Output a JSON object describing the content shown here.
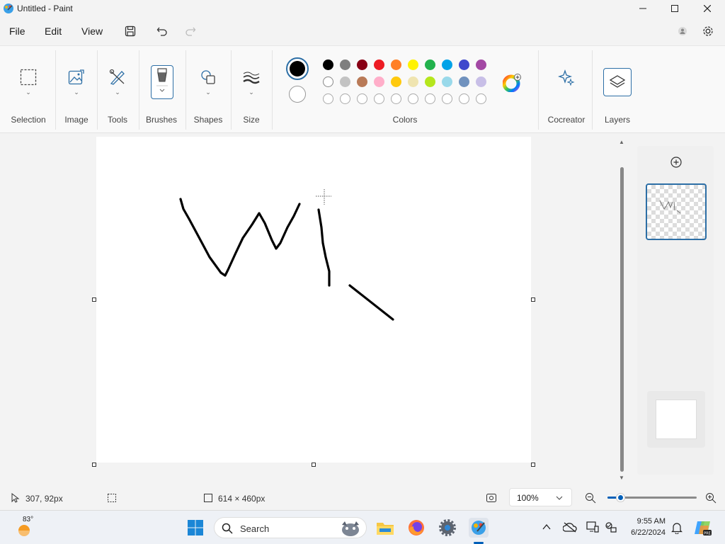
{
  "window": {
    "title": "Untitled - Paint"
  },
  "menu": {
    "file": "File",
    "edit": "Edit",
    "view": "View"
  },
  "ribbon": {
    "groups": [
      {
        "label": "Selection"
      },
      {
        "label": "Image"
      },
      {
        "label": "Tools"
      },
      {
        "label": "Brushes"
      },
      {
        "label": "Shapes"
      },
      {
        "label": "Size"
      },
      {
        "label": "Colors"
      },
      {
        "label": "Cocreator"
      },
      {
        "label": "Layers"
      }
    ],
    "colors": {
      "primary": "#000000",
      "secondary": "#ffffff",
      "palette_row1": [
        "#000000",
        "#7f7f7f",
        "#880015",
        "#ed1c24",
        "#ff7f27",
        "#fff200",
        "#22b14c",
        "#00a2e8",
        "#3f48cc",
        "#a349a4"
      ],
      "palette_row2": [
        "#ffffff",
        "#c3c3c3",
        "#b97a57",
        "#ffaec9",
        "#ffc90e",
        "#efe4b0",
        "#b5e61d",
        "#99d9ea",
        "#7092be",
        "#c8bfe7"
      ],
      "palette_row3_empty": 10
    }
  },
  "status": {
    "cursor_position": "307, 92px",
    "canvas_size": "614 × 460px",
    "zoom": "100%"
  },
  "taskbar": {
    "weather_temp": "83°",
    "search_placeholder": "Search",
    "time": "9:55 AM",
    "date": "6/22/2024"
  }
}
